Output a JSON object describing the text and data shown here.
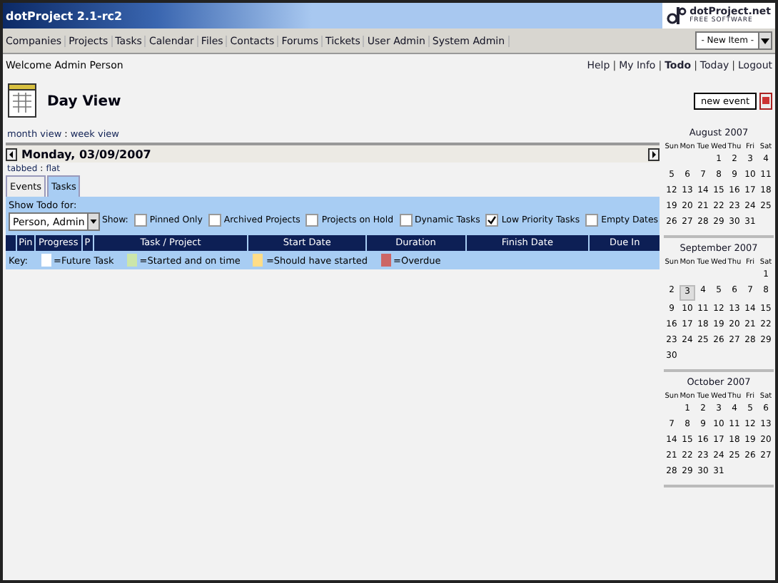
{
  "header": {
    "title": "dotProject 2.1-rc2",
    "logo_name": "dotProject.net",
    "logo_tagline": "FREE SOFTWARE"
  },
  "nav": {
    "items": [
      "Companies",
      "Projects",
      "Tasks",
      "Calendar",
      "Files",
      "Contacts",
      "Forums",
      "Tickets",
      "User Admin",
      "System Admin"
    ],
    "new_item": "- New Item -"
  },
  "welcome": "Welcome Admin Person",
  "user_links_separator": "|",
  "user_links": [
    {
      "label": "Help",
      "selected": false
    },
    {
      "label": "My Info",
      "selected": false
    },
    {
      "label": "Todo",
      "selected": true
    },
    {
      "label": "Today",
      "selected": false
    },
    {
      "label": "Logout",
      "selected": false
    }
  ],
  "page_title": "Day View",
  "new_event": "new event",
  "view_links": [
    "month view",
    "week view"
  ],
  "view_links_separator": ":",
  "date": "Monday, 03/09/2007",
  "view_modes": [
    "tabbed",
    "flat"
  ],
  "view_modes_separator": ":",
  "tabs": [
    {
      "label": "Events",
      "selected": false
    },
    {
      "label": "Tasks",
      "selected": true
    }
  ],
  "show_todo_label": "Show Todo for:",
  "person": "Person, Admin",
  "show_label": "Show:",
  "filters": [
    {
      "label": "Pinned Only",
      "checked": false
    },
    {
      "label": "Archived Projects",
      "checked": false
    },
    {
      "label": "Projects on Hold",
      "checked": false
    },
    {
      "label": "Dynamic Tasks",
      "checked": false
    },
    {
      "label": "Low Priority Tasks",
      "checked": true
    },
    {
      "label": "Empty Dates",
      "checked": false
    }
  ],
  "table": {
    "columns": [
      "Pin",
      "Progress",
      "P",
      "Task / Project",
      "Start Date",
      "Duration",
      "Finish Date",
      "Due In"
    ]
  },
  "key": {
    "label": "Key:",
    "items": [
      {
        "label": "=Future Task",
        "color": "#ffffff"
      },
      {
        "label": "=Started and on time",
        "color": "#cce6aa"
      },
      {
        "label": "=Should have started",
        "color": "#ffdd88"
      },
      {
        "label": "=Overdue",
        "color": "#cc6666"
      }
    ]
  },
  "calendars": [
    {
      "title": "August 2007",
      "weekdays": [
        "Sun",
        "Mon",
        "Tue",
        "Wed",
        "Thu",
        "Fri",
        "Sat"
      ],
      "weeks": [
        {
          "kind": "first",
          "days": [
            {
              "day": "1",
              "selected": false
            },
            {
              "day": "2",
              "selected": false
            },
            {
              "day": "3",
              "selected": false
            },
            {
              "day": "4",
              "selected": false
            }
          ]
        },
        {
          "kind": "full",
          "days": [
            {
              "day": "5",
              "selected": false
            },
            {
              "day": "6",
              "selected": false
            },
            {
              "day": "7",
              "selected": false
            },
            {
              "day": "8",
              "selected": false
            },
            {
              "day": "9",
              "selected": false
            },
            {
              "day": "10",
              "selected": false
            },
            {
              "day": "11",
              "selected": false
            }
          ]
        },
        {
          "kind": "full",
          "days": [
            {
              "day": "12",
              "selected": false
            },
            {
              "day": "13",
              "selected": false
            },
            {
              "day": "14",
              "selected": false
            },
            {
              "day": "15",
              "selected": false
            },
            {
              "day": "16",
              "selected": false
            },
            {
              "day": "17",
              "selected": false
            },
            {
              "day": "18",
              "selected": false
            }
          ]
        },
        {
          "kind": "full",
          "days": [
            {
              "day": "19",
              "selected": false
            },
            {
              "day": "20",
              "selected": false
            },
            {
              "day": "21",
              "selected": false
            },
            {
              "day": "22",
              "selected": false
            },
            {
              "day": "23",
              "selected": false
            },
            {
              "day": "24",
              "selected": false
            },
            {
              "day": "25",
              "selected": false
            }
          ]
        },
        {
          "kind": "last",
          "days": [
            {
              "day": "26",
              "selected": false
            },
            {
              "day": "27",
              "selected": false
            },
            {
              "day": "28",
              "selected": false
            },
            {
              "day": "29",
              "selected": false
            },
            {
              "day": "30",
              "selected": false
            },
            {
              "day": "31",
              "selected": false
            }
          ]
        }
      ]
    },
    {
      "title": "September 2007",
      "weekdays": [
        "Sun",
        "Mon",
        "Tue",
        "Wed",
        "Thu",
        "Fri",
        "Sat"
      ],
      "weeks": [
        {
          "kind": "first",
          "days": [
            {
              "day": "1",
              "selected": false
            }
          ]
        },
        {
          "kind": "full",
          "days": [
            {
              "day": "2",
              "selected": false
            },
            {
              "day": "3",
              "selected": true
            },
            {
              "day": "4",
              "selected": false
            },
            {
              "day": "5",
              "selected": false
            },
            {
              "day": "6",
              "selected": false
            },
            {
              "day": "7",
              "selected": false
            },
            {
              "day": "8",
              "selected": false
            }
          ]
        },
        {
          "kind": "full",
          "days": [
            {
              "day": "9",
              "selected": false
            },
            {
              "day": "10",
              "selected": false
            },
            {
              "day": "11",
              "selected": false
            },
            {
              "day": "12",
              "selected": false
            },
            {
              "day": "13",
              "selected": false
            },
            {
              "day": "14",
              "selected": false
            },
            {
              "day": "15",
              "selected": false
            }
          ]
        },
        {
          "kind": "full",
          "days": [
            {
              "day": "16",
              "selected": false
            },
            {
              "day": "17",
              "selected": false
            },
            {
              "day": "18",
              "selected": false
            },
            {
              "day": "19",
              "selected": false
            },
            {
              "day": "20",
              "selected": false
            },
            {
              "day": "21",
              "selected": false
            },
            {
              "day": "22",
              "selected": false
            }
          ]
        },
        {
          "kind": "full",
          "days": [
            {
              "day": "23",
              "selected": false
            },
            {
              "day": "24",
              "selected": false
            },
            {
              "day": "25",
              "selected": false
            },
            {
              "day": "26",
              "selected": false
            },
            {
              "day": "27",
              "selected": false
            },
            {
              "day": "28",
              "selected": false
            },
            {
              "day": "29",
              "selected": false
            }
          ]
        },
        {
          "kind": "last",
          "days": [
            {
              "day": "30",
              "selected": false
            }
          ]
        }
      ]
    },
    {
      "title": "October 2007",
      "weekdays": [
        "Sun",
        "Mon",
        "Tue",
        "Wed",
        "Thu",
        "Fri",
        "Sat"
      ],
      "weeks": [
        {
          "kind": "first",
          "days": [
            {
              "day": "1",
              "selected": false
            },
            {
              "day": "2",
              "selected": false
            },
            {
              "day": "3",
              "selected": false
            },
            {
              "day": "4",
              "selected": false
            },
            {
              "day": "5",
              "selected": false
            },
            {
              "day": "6",
              "selected": false
            }
          ]
        },
        {
          "kind": "full",
          "days": [
            {
              "day": "7",
              "selected": false
            },
            {
              "day": "8",
              "selected": false
            },
            {
              "day": "9",
              "selected": false
            },
            {
              "day": "10",
              "selected": false
            },
            {
              "day": "11",
              "selected": false
            },
            {
              "day": "12",
              "selected": false
            },
            {
              "day": "13",
              "selected": false
            }
          ]
        },
        {
          "kind": "full",
          "days": [
            {
              "day": "14",
              "selected": false
            },
            {
              "day": "15",
              "selected": false
            },
            {
              "day": "16",
              "selected": false
            },
            {
              "day": "17",
              "selected": false
            },
            {
              "day": "18",
              "selected": false
            },
            {
              "day": "19",
              "selected": false
            },
            {
              "day": "20",
              "selected": false
            }
          ]
        },
        {
          "kind": "full",
          "days": [
            {
              "day": "21",
              "selected": false
            },
            {
              "day": "22",
              "selected": false
            },
            {
              "day": "23",
              "selected": false
            },
            {
              "day": "24",
              "selected": false
            },
            {
              "day": "25",
              "selected": false
            },
            {
              "day": "26",
              "selected": false
            },
            {
              "day": "27",
              "selected": false
            }
          ]
        },
        {
          "kind": "last",
          "days": [
            {
              "day": "28",
              "selected": false
            },
            {
              "day": "29",
              "selected": false
            },
            {
              "day": "30",
              "selected": false
            },
            {
              "day": "31",
              "selected": false
            }
          ]
        }
      ]
    }
  ]
}
